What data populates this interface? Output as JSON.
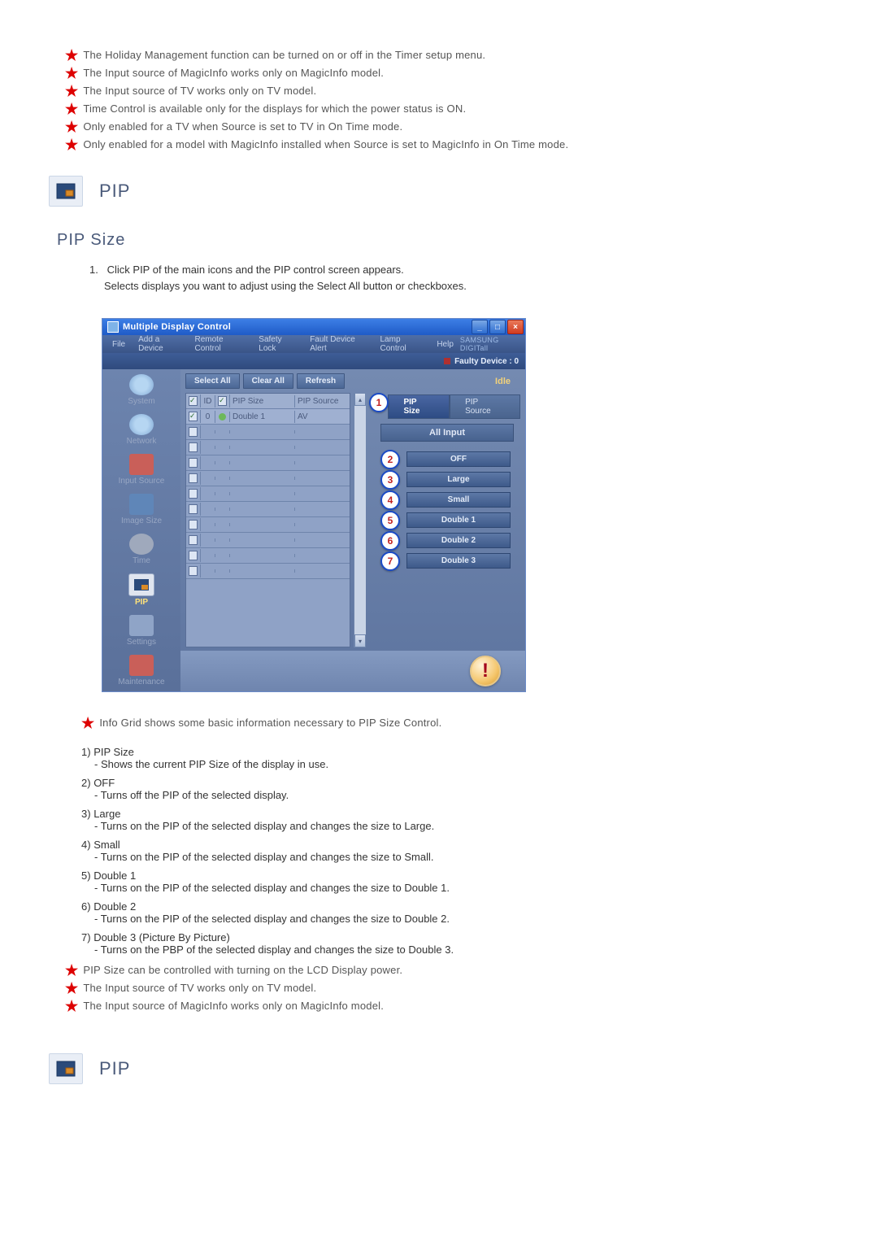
{
  "top_notes": [
    "The Holiday Management function can be turned on or off in the Timer setup menu.",
    "The Input source of MagicInfo works only on MagicInfo model.",
    "The Input source of TV works only on TV model.",
    "Time Control is available only for the displays for which the power status is ON.",
    "Only enabled for a TV when Source is set to TV in On Time mode.",
    "Only enabled for a model with MagicInfo installed when Source is set to MagicInfo in On Time mode."
  ],
  "pip_section_title": "PIP",
  "pip_subsection_title": "PIP Size",
  "pip_intro": {
    "num": "1.",
    "line1": "Click PIP of the main icons and the PIP control screen appears.",
    "line2": "Selects displays you want to adjust using the Select All button or checkboxes."
  },
  "window": {
    "title": "Multiple Display Control",
    "menus": [
      "File",
      "Add a Device",
      "Remote Control",
      "Safety Lock",
      "Fault Device Alert",
      "Lamp Control",
      "Help"
    ],
    "brand": "SAMSUNG DIGITall",
    "faulty": "Faulty Device : 0",
    "toolbar": {
      "select_all": "Select All",
      "clear_all": "Clear All",
      "refresh": "Refresh",
      "idle": "Idle"
    },
    "side": [
      {
        "label": "System",
        "active": false
      },
      {
        "label": "Network",
        "active": false
      },
      {
        "label": "Input Source",
        "active": false
      },
      {
        "label": "Image Size",
        "active": false
      },
      {
        "label": "Time",
        "active": false
      },
      {
        "label": "PIP",
        "active": true
      },
      {
        "label": "Settings",
        "active": false
      },
      {
        "label": "Maintenance",
        "active": false
      }
    ],
    "grid": {
      "headers": {
        "id": "ID",
        "size": "PIP Size",
        "src": "PIP Source"
      },
      "row": {
        "id": "0",
        "size": "Double 1",
        "src": "AV"
      }
    },
    "tabs": {
      "size": "PIP Size",
      "source": "PIP Source"
    },
    "all_input": "All Input",
    "buttons": [
      "OFF",
      "Large",
      "Small",
      "Double 1",
      "Double 2",
      "Double 3"
    ],
    "markers": [
      "1",
      "2",
      "3",
      "4",
      "5",
      "6",
      "7"
    ]
  },
  "mid_note": "Info Grid shows some basic information necessary to PIP Size Control.",
  "desc_items": [
    {
      "n": "1)",
      "t": "PIP Size",
      "s": "Shows the current PIP Size of the display in use."
    },
    {
      "n": "2)",
      "t": "OFF",
      "s": "Turns off the PIP of the selected display."
    },
    {
      "n": "3)",
      "t": "Large",
      "s": "Turns on the PIP of the selected display and changes the size to Large."
    },
    {
      "n": "4)",
      "t": "Small",
      "s": "Turns on the PIP of the selected display and changes the size to Small."
    },
    {
      "n": "5)",
      "t": "Double 1",
      "s": "Turns on the PIP of the selected display and changes the size to Double 1."
    },
    {
      "n": "6)",
      "t": "Double 2",
      "s": "Turns on the PIP of the selected display and changes the size to Double 2."
    },
    {
      "n": "7)",
      "t": "Double 3 (Picture By Picture)",
      "s": "Turns on the PBP of the selected display and changes the size to Double 3."
    }
  ],
  "bottom_notes": [
    "PIP Size can be controlled with turning on the LCD Display power.",
    "The Input source of TV works only on TV model.",
    "The Input source of MagicInfo works only on MagicInfo model."
  ],
  "pip_section_title_2": "PIP"
}
